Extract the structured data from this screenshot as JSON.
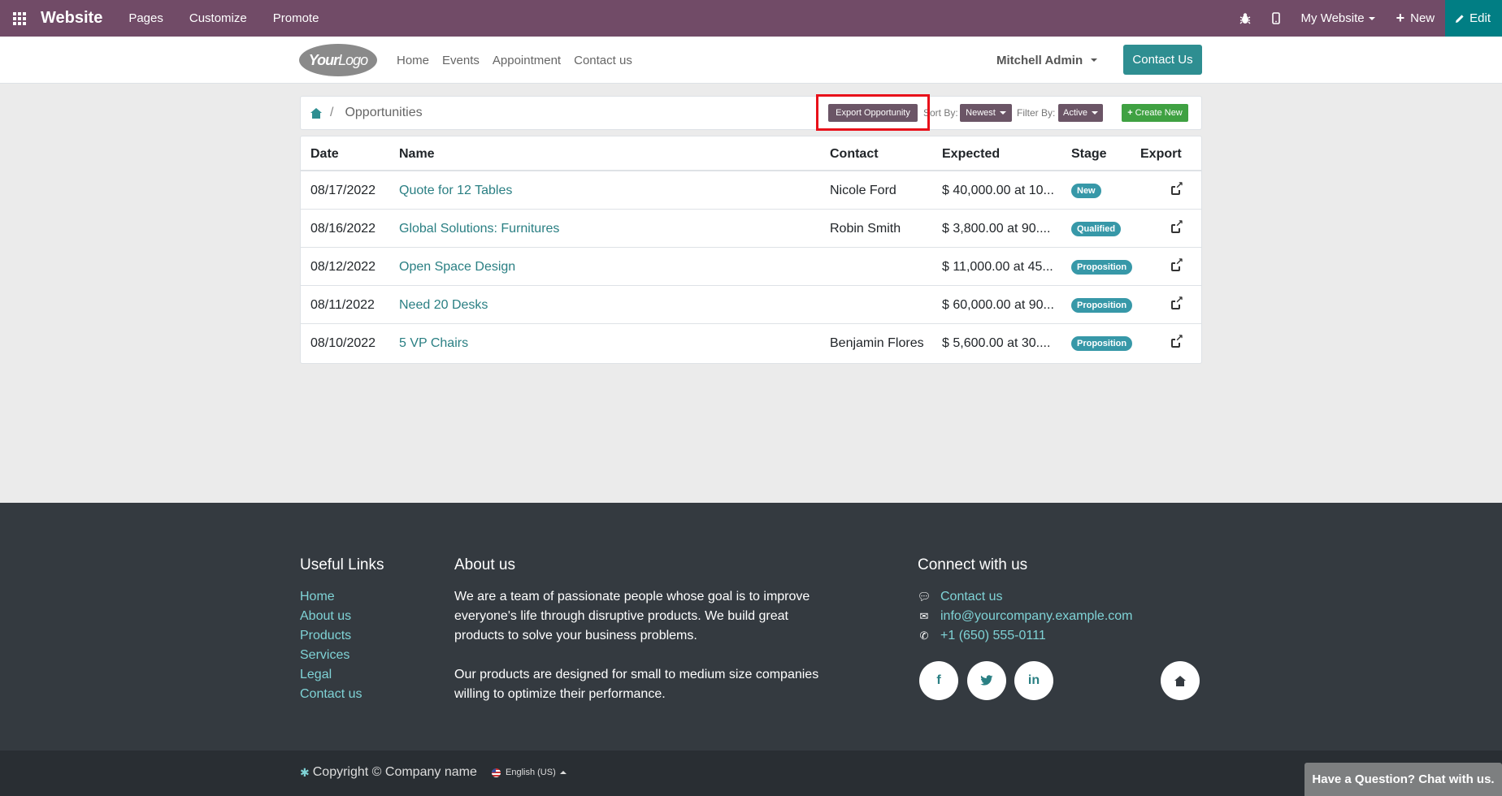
{
  "topbar": {
    "brand": "Website",
    "menu": [
      "Pages",
      "Customize",
      "Promote"
    ],
    "my_website": "My Website",
    "new_label": "New",
    "edit_label": "Edit"
  },
  "header": {
    "logo_your": "Your",
    "logo_logo": "Logo",
    "nav": [
      "Home",
      "Events",
      "Appointment",
      "Contact us"
    ],
    "user": "Mitchell Admin",
    "contact_button": "Contact Us"
  },
  "breadcrumb": {
    "sep": "/",
    "current": "Opportunities"
  },
  "toolbar": {
    "export_label": "Export Opportunity",
    "sort_label": "Sort By:",
    "sort_value": "Newest",
    "filter_label": "Filter By:",
    "filter_value": "Active",
    "create_label": "Create New"
  },
  "table": {
    "headers": [
      "Date",
      "Name",
      "Contact",
      "Expected",
      "Stage",
      "Export"
    ],
    "rows": [
      {
        "date": "08/17/2022",
        "name": "Quote for 12 Tables",
        "contact": "Nicole Ford",
        "expected": "$ 40,000.00 at 10...",
        "stage": "New"
      },
      {
        "date": "08/16/2022",
        "name": "Global Solutions: Furnitures",
        "contact": "Robin Smith",
        "expected": "$ 3,800.00 at 90....",
        "stage": "Qualified"
      },
      {
        "date": "08/12/2022",
        "name": "Open Space Design",
        "contact": "",
        "expected": "$ 11,000.00 at 45...",
        "stage": "Proposition"
      },
      {
        "date": "08/11/2022",
        "name": "Need 20 Desks",
        "contact": "",
        "expected": "$ 60,000.00 at 90...",
        "stage": "Proposition"
      },
      {
        "date": "08/10/2022",
        "name": "5 VP Chairs",
        "contact": "Benjamin Flores",
        "expected": "$ 5,600.00 at 30....",
        "stage": "Proposition"
      }
    ]
  },
  "footer": {
    "useful_links_title": "Useful Links",
    "useful_links": [
      "Home",
      "About us",
      "Products",
      "Services",
      "Legal",
      "Contact us"
    ],
    "about_title": "About us",
    "about_p1": "We are a team of passionate people whose goal is to improve everyone's life through disruptive products. We build great products to solve your business problems.",
    "about_p2": "Our products are designed for small to medium size companies willing to optimize their performance.",
    "connect_title": "Connect with us",
    "contact_link": "Contact us",
    "email": "info@yourcompany.example.com",
    "phone": "+1 (650) 555-0111",
    "social": [
      "f",
      "in"
    ]
  },
  "bottom": {
    "copyright": "Copyright © Company name",
    "language": "English (US)"
  },
  "chat_label": "Have a Question? Chat with us."
}
